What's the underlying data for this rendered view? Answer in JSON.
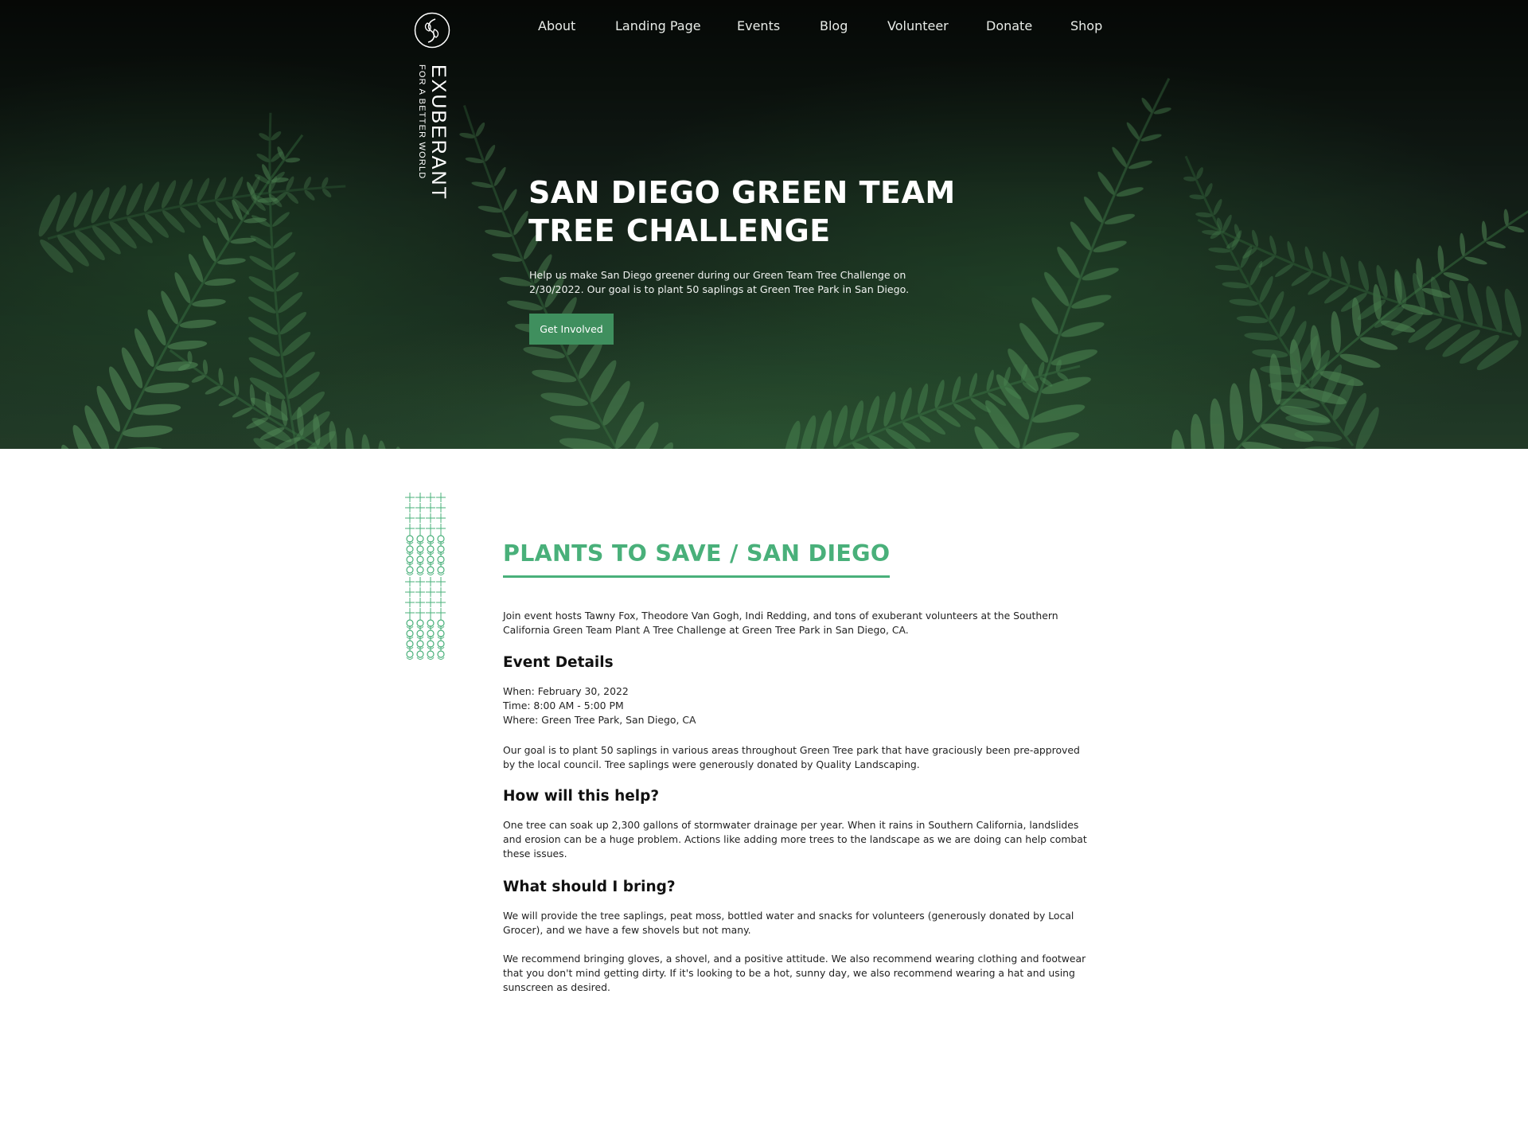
{
  "brand": {
    "name": "EXUBERANT",
    "tagline": "FOR A BETTER WORLD",
    "logo_icon": "leaf-monogram-icon"
  },
  "nav": {
    "items": [
      {
        "label": "About"
      },
      {
        "label": "Landing Page"
      },
      {
        "label": "Events"
      },
      {
        "label": "Blog"
      },
      {
        "label": "Volunteer"
      },
      {
        "label": "Donate"
      },
      {
        "label": "Shop"
      }
    ]
  },
  "hero": {
    "title_line1": "SAN DIEGO GREEN TEAM",
    "title_line2": "TREE CHALLENGE",
    "description": "Help us make San Diego greener during our Green Team Tree Challenge on 2/30/2022. Our goal is to plant 50 saplings at Green Tree Park in San Diego.",
    "cta_label": "Get Involved",
    "background": "fern-photo"
  },
  "content": {
    "section_title": "PLANTS TO SAVE / SAN DIEGO",
    "intro": "Join event hosts Tawny Fox, Theodore Van Gogh, Indi Redding, and tons of exuberant volunteers at the Southern California Green Team Plant A Tree Challenge at Green Tree Park in San Diego, CA.",
    "event_details_heading": "Event Details",
    "when": "When: February 30, 2022",
    "time": "Time: 8:00 AM - 5:00 PM",
    "where": "Where: Green Tree Park, San Diego, CA",
    "goal": "Our goal is to plant 50 saplings in various areas throughout Green Tree park that have graciously been pre-approved by the local council. Tree saplings were generously donated by Quality Landscaping.",
    "help_heading": "How will this help?",
    "help_text": "One tree can soak up 2,300 gallons of stormwater drainage per year. When it rains in Southern California, landslides and erosion can be a huge problem. Actions like adding more trees to the landscape as we are doing can help combat these issues.",
    "bring_heading": "What should I bring?",
    "bring_text1": "We will provide the tree saplings, peat moss, bottled water and snacks for volunteers (generously donated by Local Grocer), and we have a few shovels but not many.",
    "bring_text2": "We recommend bringing gloves, a shovel, and a positive attitude. We also recommend wearing clothing and footwear that you don't mind getting dirty. If it's looking to be a hot, sunny day, we also recommend wearing a hat and using sunscreen as desired."
  },
  "colors": {
    "accent": "#49b07a",
    "button": "#3f8f5e",
    "hero_dark": "#0b100c"
  },
  "decor": {
    "side_pattern": "botanical-pattern-icon"
  }
}
